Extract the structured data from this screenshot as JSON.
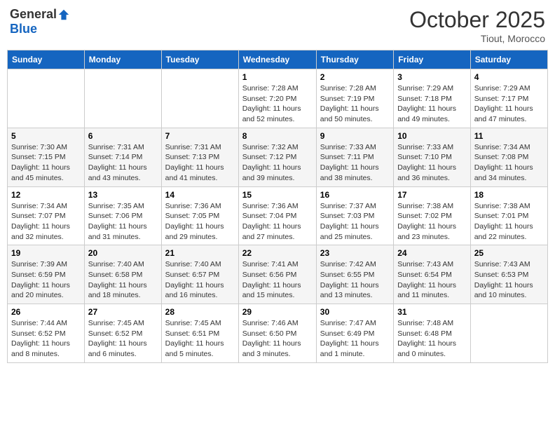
{
  "logo": {
    "general": "General",
    "blue": "Blue"
  },
  "header": {
    "month": "October 2025",
    "location": "Tiout, Morocco"
  },
  "weekdays": [
    "Sunday",
    "Monday",
    "Tuesday",
    "Wednesday",
    "Thursday",
    "Friday",
    "Saturday"
  ],
  "weeks": [
    [
      {
        "day": "",
        "info": ""
      },
      {
        "day": "",
        "info": ""
      },
      {
        "day": "",
        "info": ""
      },
      {
        "day": "1",
        "info": "Sunrise: 7:28 AM\nSunset: 7:20 PM\nDaylight: 11 hours\nand 52 minutes."
      },
      {
        "day": "2",
        "info": "Sunrise: 7:28 AM\nSunset: 7:19 PM\nDaylight: 11 hours\nand 50 minutes."
      },
      {
        "day": "3",
        "info": "Sunrise: 7:29 AM\nSunset: 7:18 PM\nDaylight: 11 hours\nand 49 minutes."
      },
      {
        "day": "4",
        "info": "Sunrise: 7:29 AM\nSunset: 7:17 PM\nDaylight: 11 hours\nand 47 minutes."
      }
    ],
    [
      {
        "day": "5",
        "info": "Sunrise: 7:30 AM\nSunset: 7:15 PM\nDaylight: 11 hours\nand 45 minutes."
      },
      {
        "day": "6",
        "info": "Sunrise: 7:31 AM\nSunset: 7:14 PM\nDaylight: 11 hours\nand 43 minutes."
      },
      {
        "day": "7",
        "info": "Sunrise: 7:31 AM\nSunset: 7:13 PM\nDaylight: 11 hours\nand 41 minutes."
      },
      {
        "day": "8",
        "info": "Sunrise: 7:32 AM\nSunset: 7:12 PM\nDaylight: 11 hours\nand 39 minutes."
      },
      {
        "day": "9",
        "info": "Sunrise: 7:33 AM\nSunset: 7:11 PM\nDaylight: 11 hours\nand 38 minutes."
      },
      {
        "day": "10",
        "info": "Sunrise: 7:33 AM\nSunset: 7:10 PM\nDaylight: 11 hours\nand 36 minutes."
      },
      {
        "day": "11",
        "info": "Sunrise: 7:34 AM\nSunset: 7:08 PM\nDaylight: 11 hours\nand 34 minutes."
      }
    ],
    [
      {
        "day": "12",
        "info": "Sunrise: 7:34 AM\nSunset: 7:07 PM\nDaylight: 11 hours\nand 32 minutes."
      },
      {
        "day": "13",
        "info": "Sunrise: 7:35 AM\nSunset: 7:06 PM\nDaylight: 11 hours\nand 31 minutes."
      },
      {
        "day": "14",
        "info": "Sunrise: 7:36 AM\nSunset: 7:05 PM\nDaylight: 11 hours\nand 29 minutes."
      },
      {
        "day": "15",
        "info": "Sunrise: 7:36 AM\nSunset: 7:04 PM\nDaylight: 11 hours\nand 27 minutes."
      },
      {
        "day": "16",
        "info": "Sunrise: 7:37 AM\nSunset: 7:03 PM\nDaylight: 11 hours\nand 25 minutes."
      },
      {
        "day": "17",
        "info": "Sunrise: 7:38 AM\nSunset: 7:02 PM\nDaylight: 11 hours\nand 23 minutes."
      },
      {
        "day": "18",
        "info": "Sunrise: 7:38 AM\nSunset: 7:01 PM\nDaylight: 11 hours\nand 22 minutes."
      }
    ],
    [
      {
        "day": "19",
        "info": "Sunrise: 7:39 AM\nSunset: 6:59 PM\nDaylight: 11 hours\nand 20 minutes."
      },
      {
        "day": "20",
        "info": "Sunrise: 7:40 AM\nSunset: 6:58 PM\nDaylight: 11 hours\nand 18 minutes."
      },
      {
        "day": "21",
        "info": "Sunrise: 7:40 AM\nSunset: 6:57 PM\nDaylight: 11 hours\nand 16 minutes."
      },
      {
        "day": "22",
        "info": "Sunrise: 7:41 AM\nSunset: 6:56 PM\nDaylight: 11 hours\nand 15 minutes."
      },
      {
        "day": "23",
        "info": "Sunrise: 7:42 AM\nSunset: 6:55 PM\nDaylight: 11 hours\nand 13 minutes."
      },
      {
        "day": "24",
        "info": "Sunrise: 7:43 AM\nSunset: 6:54 PM\nDaylight: 11 hours\nand 11 minutes."
      },
      {
        "day": "25",
        "info": "Sunrise: 7:43 AM\nSunset: 6:53 PM\nDaylight: 11 hours\nand 10 minutes."
      }
    ],
    [
      {
        "day": "26",
        "info": "Sunrise: 7:44 AM\nSunset: 6:52 PM\nDaylight: 11 hours\nand 8 minutes."
      },
      {
        "day": "27",
        "info": "Sunrise: 7:45 AM\nSunset: 6:52 PM\nDaylight: 11 hours\nand 6 minutes."
      },
      {
        "day": "28",
        "info": "Sunrise: 7:45 AM\nSunset: 6:51 PM\nDaylight: 11 hours\nand 5 minutes."
      },
      {
        "day": "29",
        "info": "Sunrise: 7:46 AM\nSunset: 6:50 PM\nDaylight: 11 hours\nand 3 minutes."
      },
      {
        "day": "30",
        "info": "Sunrise: 7:47 AM\nSunset: 6:49 PM\nDaylight: 11 hours\nand 1 minute."
      },
      {
        "day": "31",
        "info": "Sunrise: 7:48 AM\nSunset: 6:48 PM\nDaylight: 11 hours\nand 0 minutes."
      },
      {
        "day": "",
        "info": ""
      }
    ]
  ]
}
